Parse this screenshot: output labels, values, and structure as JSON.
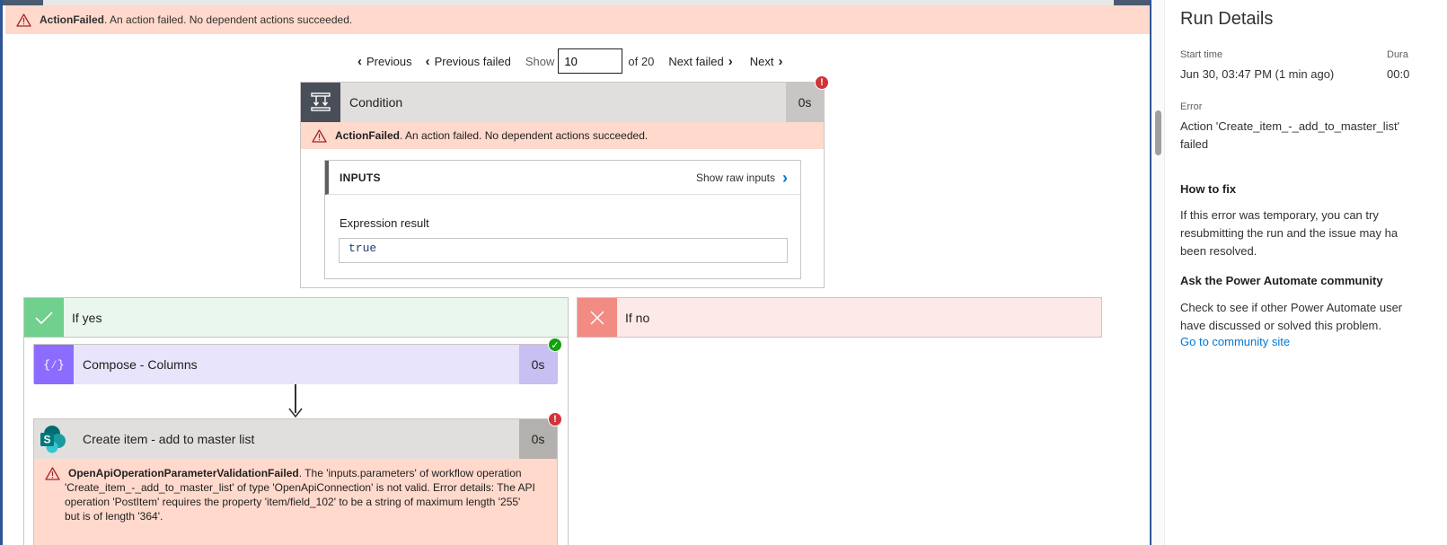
{
  "top_banner": {
    "code": "ActionFailed",
    "message": ". An action failed. No dependent actions succeeded."
  },
  "pager": {
    "previous": "Previous",
    "previous_failed": "Previous failed",
    "show": "Show",
    "value": "10",
    "of": "of 20",
    "next_failed": "Next failed",
    "next": "Next"
  },
  "condition": {
    "title": "Condition",
    "duration": "0s",
    "error_code": "ActionFailed",
    "error_message": ". An action failed. No dependent actions succeeded.",
    "inputs_title": "INPUTS",
    "show_raw": "Show raw inputs",
    "expression_label": "Expression result",
    "expression_value": "true"
  },
  "if_yes": {
    "label": "If yes"
  },
  "if_no": {
    "label": "If no"
  },
  "compose": {
    "title": "Compose - Columns",
    "duration": "0s"
  },
  "create_item": {
    "title": "Create item - add to master list",
    "duration": "0s",
    "error_code": "OpenApiOperationParameterValidationFailed",
    "error_line1": ". The 'inputs.parameters' of workflow operation",
    "error_line2": "'Create_item_-_add_to_master_list' of type 'OpenApiConnection' is not valid. Error details: The API",
    "error_line3": "operation 'PostItem' requires the property 'item/field_102' to be a string of maximum length '255'",
    "error_line4": "but is of length '364'."
  },
  "panel": {
    "title": "Run Details",
    "start_label": "Start time",
    "start_value": "Jun 30, 03:47 PM (1 min ago)",
    "duration_label": "Dura",
    "duration_value": "00:0",
    "error_label": "Error",
    "error_line1": "Action 'Create_item_-_add_to_master_list'",
    "error_line2": "failed",
    "howto_title": "How to fix",
    "howto_line1": "If this error was temporary, you can try",
    "howto_line2": "resubmitting the run and the issue may ha",
    "howto_line3": "been resolved.",
    "community_title": "Ask the Power Automate community",
    "community_line1": "Check to see if other Power Automate user",
    "community_line2": "have discussed or solved this problem.",
    "community_link": "Go to community site"
  },
  "colors": {
    "error_strip": "#fed9cc",
    "condition_icon": "#484f58",
    "compose_icon": "#8c6cff",
    "compose_bg": "#e8e4fb",
    "yes_icon": "#70d08e",
    "yes_bg": "#e9f7ec",
    "no_icon": "#f28b83",
    "no_bg": "#fce9e8",
    "link": "#0078d4"
  }
}
